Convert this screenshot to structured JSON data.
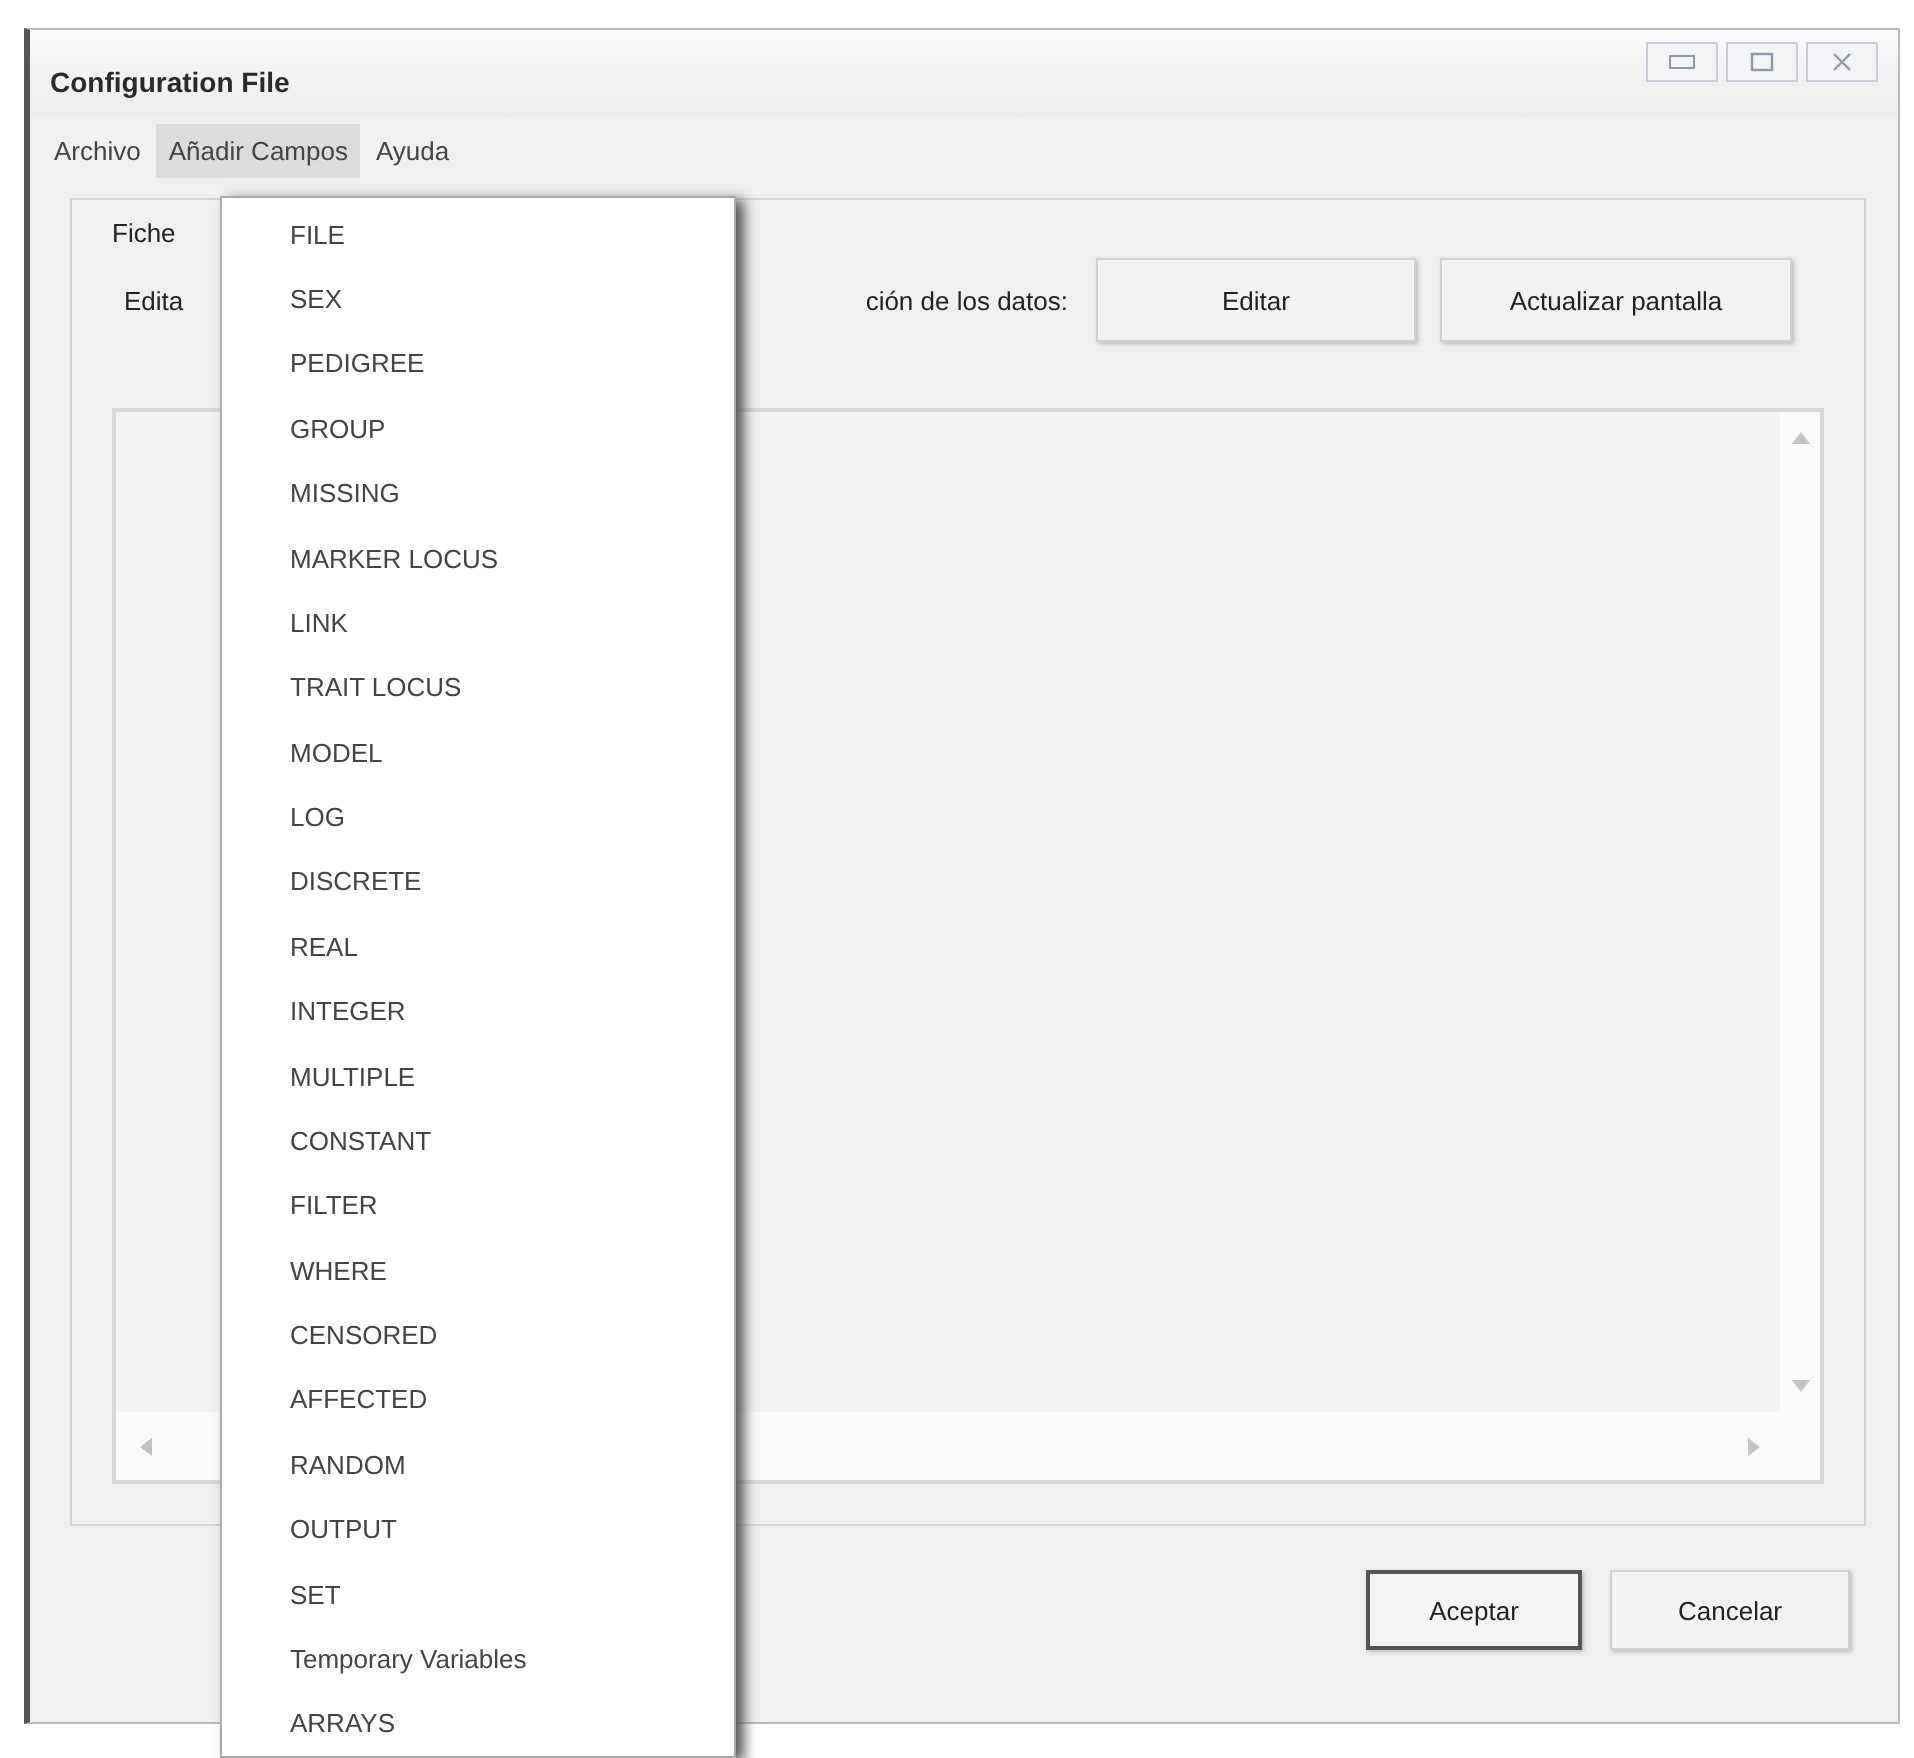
{
  "window": {
    "title": "Configuration File"
  },
  "menu_bar": [
    {
      "label": "Archivo",
      "selected": false
    },
    {
      "label": "Añadir Campos",
      "selected": true
    },
    {
      "label": "Ayuda",
      "selected": false
    }
  ],
  "form": {
    "line_1": "Fiche",
    "line_2_start": "Edita",
    "line_2_end": "ción de los datos:",
    "buttons": [
      "Editar",
      "Actualizar pantalla"
    ]
  },
  "dialog_buttons": [
    {
      "label": "Aceptar",
      "default": true
    },
    {
      "label": "Cancelar",
      "default": false
    }
  ],
  "dropdown_menu": [
    {
      "label": "FILE",
      "selected": false
    },
    {
      "label": "SEX",
      "selected": false
    },
    {
      "label": "PEDIGREE",
      "selected": false
    },
    {
      "label": "GROUP",
      "selected": false
    },
    {
      "label": "MISSING",
      "selected": false
    },
    {
      "label": "MARKER LOCUS",
      "selected": false
    },
    {
      "label": "LINK",
      "selected": false
    },
    {
      "label": "TRAIT LOCUS",
      "selected": false
    },
    {
      "label": "MODEL",
      "selected": false
    },
    {
      "label": "LOG",
      "selected": false
    },
    {
      "label": "DISCRETE",
      "selected": false
    },
    {
      "label": "REAL",
      "selected": false
    },
    {
      "label": "INTEGER",
      "selected": false
    },
    {
      "label": "MULTIPLE",
      "selected": false
    },
    {
      "label": "CONSTANT",
      "selected": false
    },
    {
      "label": "FILTER",
      "selected": false
    },
    {
      "label": "WHERE",
      "selected": false
    },
    {
      "label": "CENSORED",
      "selected": false
    },
    {
      "label": "AFFECTED",
      "selected": false
    },
    {
      "label": "RANDOM",
      "selected": false
    },
    {
      "label": "OUTPUT",
      "selected": false
    },
    {
      "label": "SET",
      "selected": false
    },
    {
      "label": "Temporary Variables",
      "selected": false
    },
    {
      "label": "ARRAYS",
      "selected": false
    }
  ]
}
